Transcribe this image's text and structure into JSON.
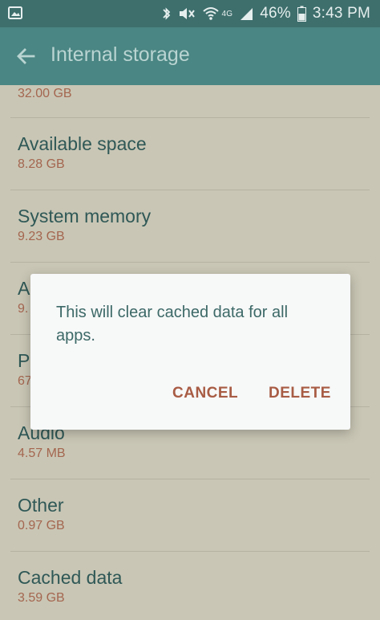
{
  "status_bar": {
    "battery_percent": "46%",
    "time": "3:43 PM",
    "network": "4G",
    "icons": [
      "image-icon",
      "bluetooth-icon",
      "mute-icon",
      "wifi-icon",
      "signal-icon",
      "battery-icon"
    ]
  },
  "app_bar": {
    "title": "Internal storage",
    "back_icon": "arrow-left-icon"
  },
  "list": {
    "items": [
      {
        "title": "",
        "value": "32.00 GB"
      },
      {
        "title": "Available space",
        "value": "8.28 GB"
      },
      {
        "title": "System memory",
        "value": "9.23 GB"
      },
      {
        "title": "A",
        "value": "9."
      },
      {
        "title": "P",
        "value": "67"
      },
      {
        "title": "Audio",
        "value": "4.57 MB"
      },
      {
        "title": "Other",
        "value": "0.97 GB"
      },
      {
        "title": "Cached data",
        "value": "3.59 GB"
      }
    ]
  },
  "dialog": {
    "message": "This will clear cached data for all apps.",
    "cancel_label": "CANCEL",
    "delete_label": "DELETE"
  },
  "colors": {
    "status_bar": "#3e6f6d",
    "app_bar": "#4a8683",
    "background": "#c9c6b5",
    "title_text": "#2f5856",
    "value_text": "#a4664f",
    "dialog_button": "#a85c44"
  }
}
